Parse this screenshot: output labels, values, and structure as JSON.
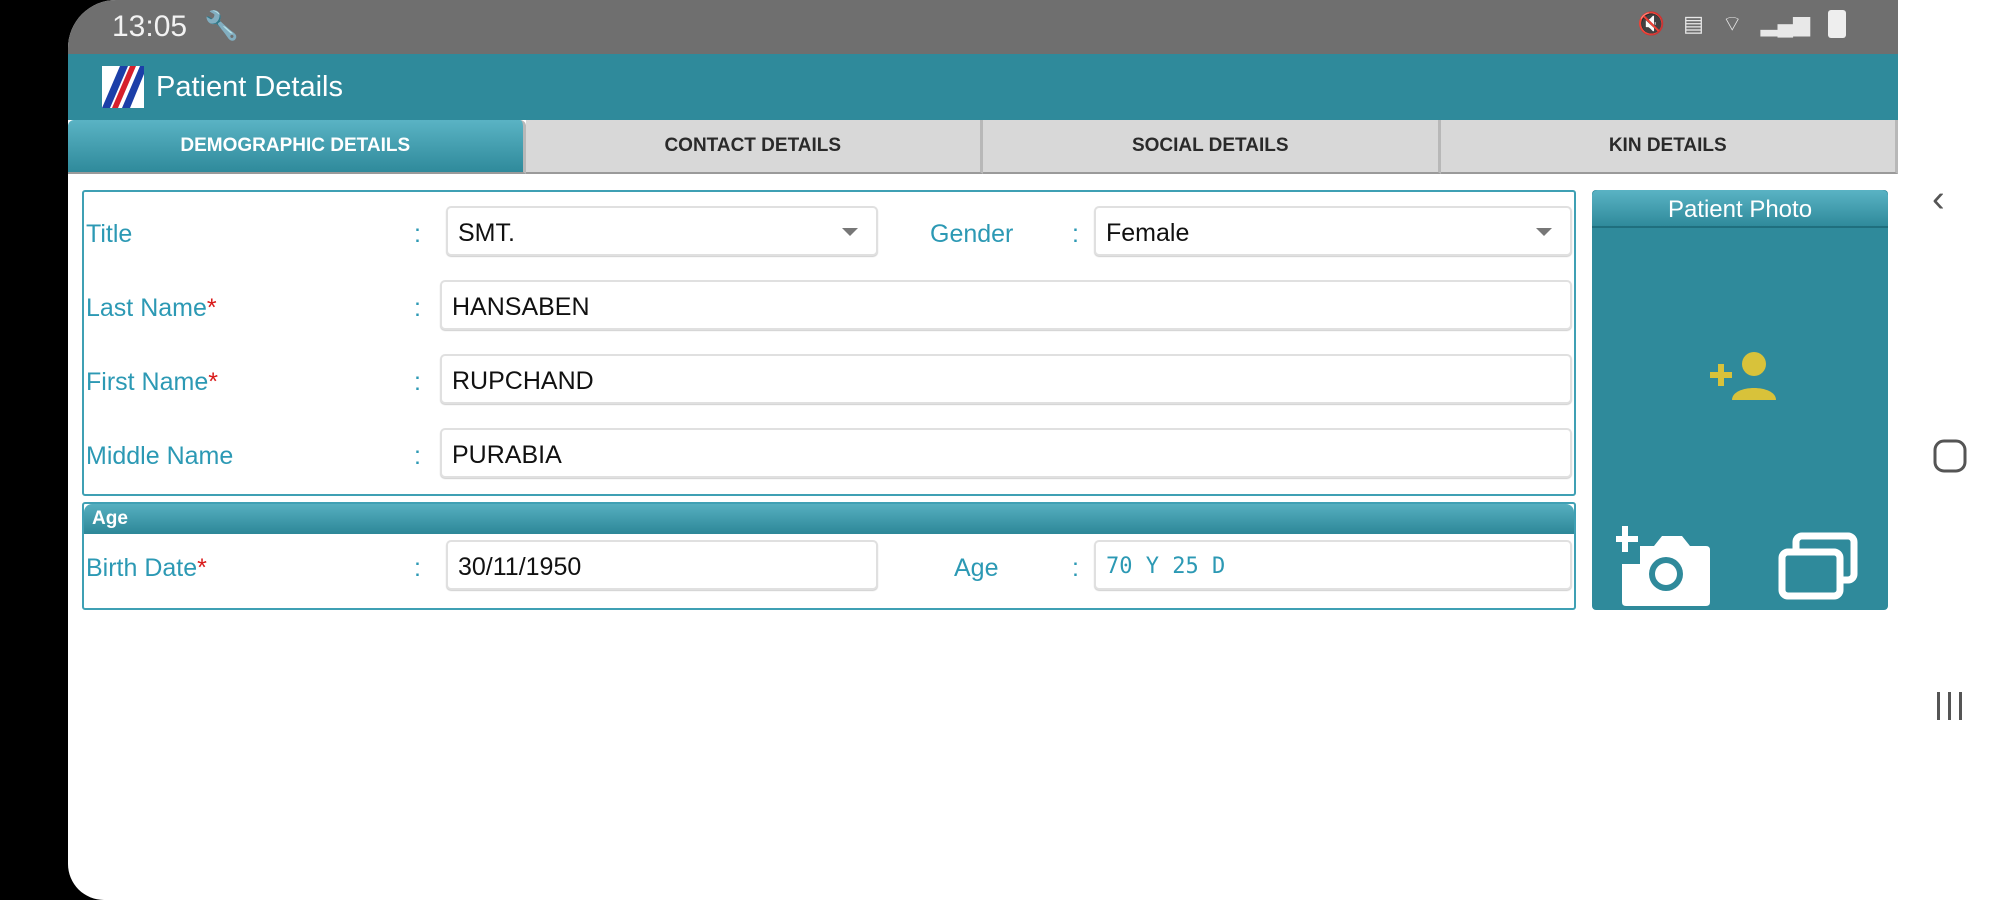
{
  "status_bar": {
    "time": "13:05"
  },
  "app_bar": {
    "title": "Patient Details"
  },
  "tabs": [
    {
      "label": "DEMOGRAPHIC DETAILS",
      "active": true
    },
    {
      "label": "CONTACT DETAILS",
      "active": false
    },
    {
      "label": "SOCIAL DETAILS",
      "active": false
    },
    {
      "label": "KIN DETAILS",
      "active": false
    }
  ],
  "form": {
    "colon": ":",
    "required_marker": "*",
    "title": {
      "label": "Title",
      "value": "SMT."
    },
    "gender": {
      "label": "Gender",
      "value": "Female"
    },
    "last_name": {
      "label": "Last Name",
      "value": "HANSABEN"
    },
    "first_name": {
      "label": "First Name",
      "value": "RUPCHAND"
    },
    "middle_name": {
      "label": "Middle Name",
      "value": "PURABIA"
    }
  },
  "age_section": {
    "header": "Age",
    "birth_date": {
      "label": "Birth Date",
      "value": "30/11/1950"
    },
    "age": {
      "label": "Age",
      "value": "70 Y 25 D"
    }
  },
  "photo_panel": {
    "title": "Patient Photo"
  },
  "colors": {
    "primary": "#2f8a9b",
    "label": "#2c99b4",
    "required": "#d91a1a",
    "icon_accent": "#d8c23a"
  },
  "icons": [
    "wrench-icon",
    "mute-icon",
    "volte-icon",
    "wifi-icon",
    "signal-icon",
    "battery-icon",
    "app-logo-icon",
    "dropdown-caret-icon",
    "add-person-icon",
    "camera-add-icon",
    "gallery-icon",
    "back-icon",
    "home-icon",
    "recents-icon"
  ]
}
